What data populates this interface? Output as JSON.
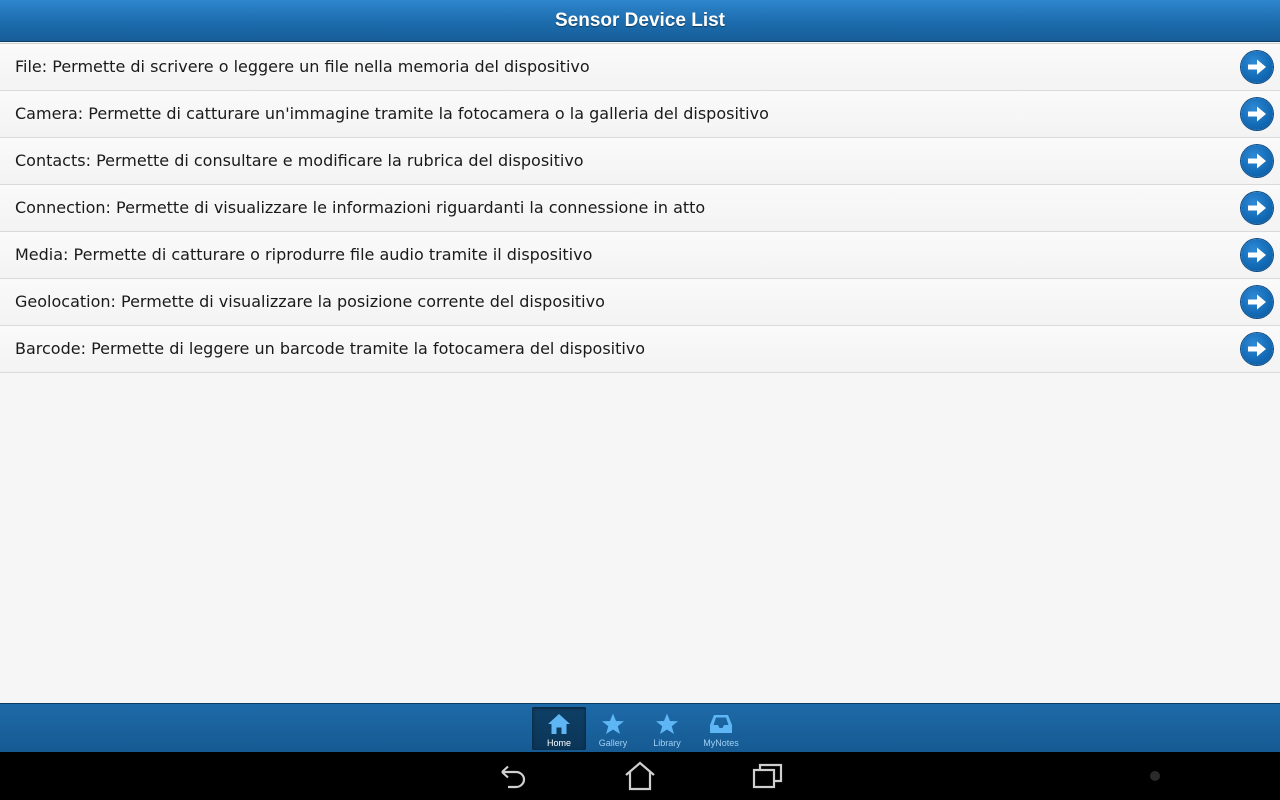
{
  "header": {
    "title": "Sensor Device List"
  },
  "list": {
    "items": [
      {
        "label": "File: Permette di scrivere o leggere un file nella memoria del dispositivo",
        "icon": "arrow-right-circle-icon"
      },
      {
        "label": "Camera: Permette di catturare un'immagine tramite la fotocamera o la galleria del dispositivo",
        "icon": "arrow-right-circle-icon"
      },
      {
        "label": "Contacts: Permette di consultare e modificare la rubrica del dispositivo",
        "icon": "arrow-right-circle-icon"
      },
      {
        "label": "Connection: Permette di visualizzare le informazioni riguardanti la connessione in atto",
        "icon": "arrow-right-circle-icon"
      },
      {
        "label": "Media: Permette di catturare o riprodurre file audio tramite il dispositivo",
        "icon": "arrow-right-circle-icon"
      },
      {
        "label": "Geolocation: Permette di visualizzare la posizione corrente del dispositivo",
        "icon": "arrow-right-circle-icon"
      },
      {
        "label": "Barcode: Permette di leggere un barcode tramite la fotocamera del dispositivo",
        "icon": "arrow-right-circle-icon"
      }
    ]
  },
  "tabbar": {
    "tabs": [
      {
        "label": "Home",
        "icon": "home-icon",
        "active": true
      },
      {
        "label": "Gallery",
        "icon": "star-icon",
        "active": false
      },
      {
        "label": "Library",
        "icon": "star-icon",
        "active": false
      },
      {
        "label": "MyNotes",
        "icon": "inbox-icon",
        "active": false
      }
    ]
  },
  "system_nav": {
    "buttons": [
      "back-icon",
      "home-icon",
      "recent-apps-icon"
    ]
  },
  "colors": {
    "header_blue": "#1c6cad",
    "accent_blue": "#1269b4",
    "tab_label": "#9fd0f5",
    "nav_background": "#000000"
  }
}
